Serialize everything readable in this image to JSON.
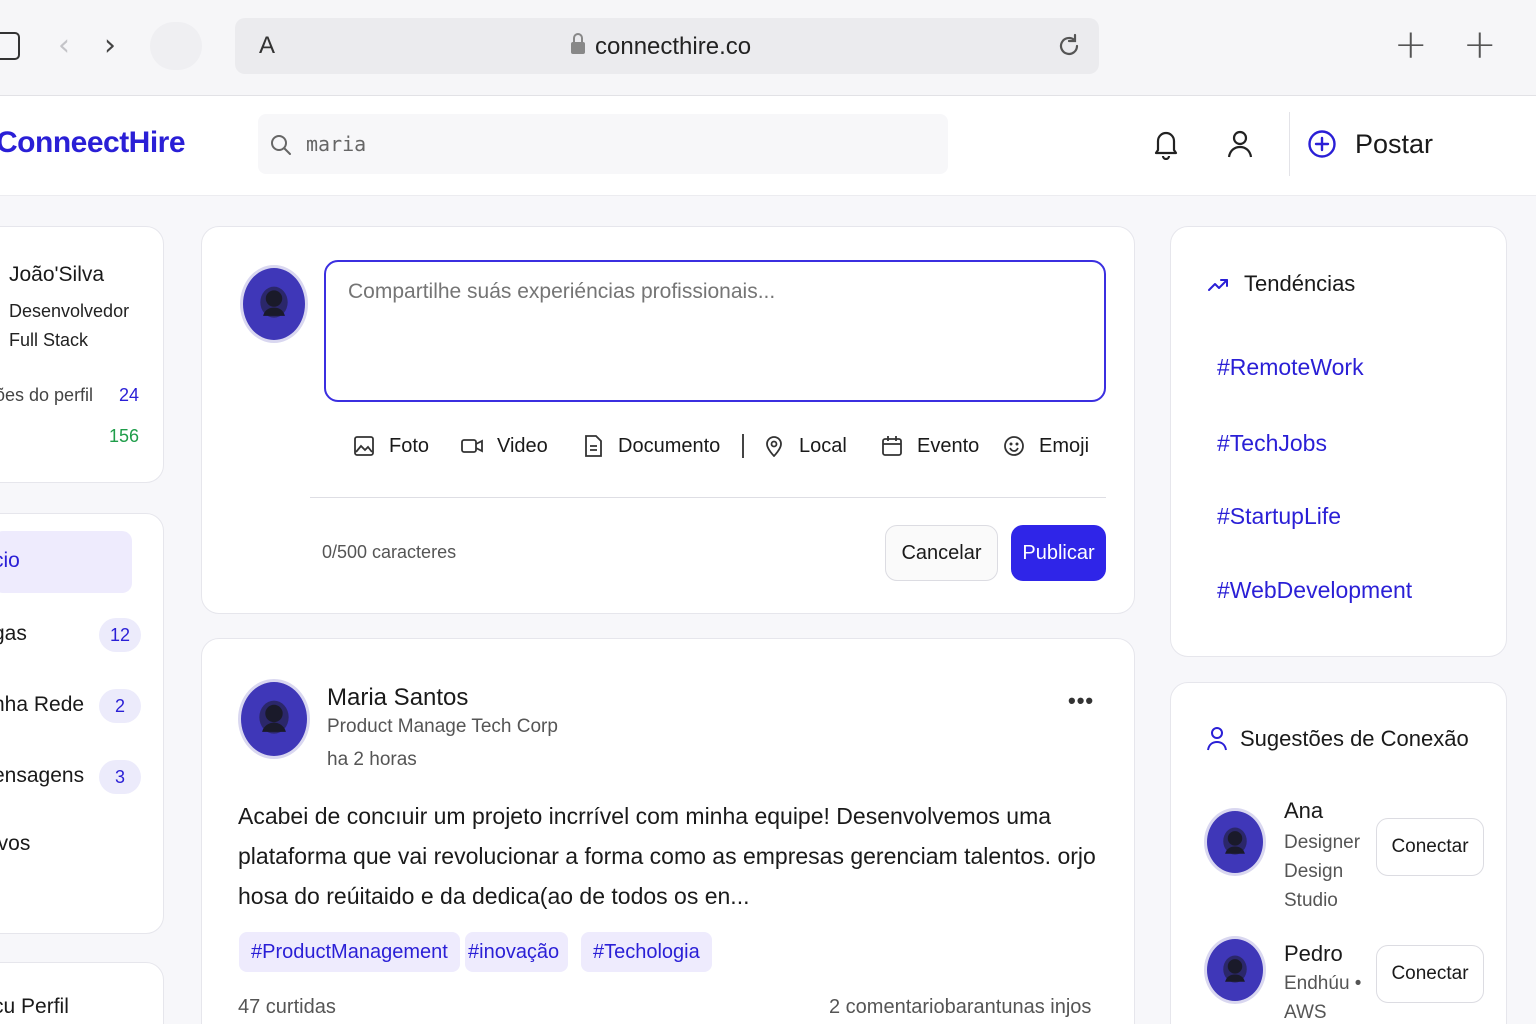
{
  "browser": {
    "reader_label": "A",
    "url": "connecthire.co"
  },
  "header": {
    "logo": "ConneectHire",
    "search_value": "maria",
    "post_label": "Postar"
  },
  "profile": {
    "name": "João'Silva",
    "role": "Desenvolvedor Full Stack",
    "stats": [
      {
        "label": "ões do perfil",
        "value": "24",
        "color": "#2a1fd6"
      },
      {
        "label": "",
        "value": "156",
        "color": "#1f9d4a"
      }
    ]
  },
  "nav": {
    "items": [
      {
        "label": "cio",
        "badge": "",
        "active": true
      },
      {
        "label": "gas",
        "badge": "12"
      },
      {
        "label": "nha Rede",
        "badge": "2"
      },
      {
        "label": "ensagens",
        "badge": "3"
      },
      {
        "label": "lvos",
        "badge": ""
      }
    ],
    "my_profile": "cu Perfil"
  },
  "composer": {
    "placeholder": "Compartilhe suás experiéncias profissionais...",
    "attachments": [
      "Foto",
      "Video",
      "Documento",
      "Local",
      "Evento",
      "Emoji"
    ],
    "counter": "0/500 caracteres",
    "cancel": "Cancelar",
    "publish": "Publicar"
  },
  "post": {
    "author": "Maria Santos",
    "subtitle": "Product Manage Tech Corp",
    "time": "ha 2 horas",
    "more": "•••",
    "body": "Acabei de concıuir um projeto incrrível com minha equipe! Desenvolvemos uma plataforma que vai revolucionar a forma como as empresas gerenciam talentos. orjo hosa do reúitaido e da dedica(ao de todos os en...",
    "tags": [
      "#ProductManagement",
      "#inovação",
      "#Techologia"
    ],
    "likes": "47 curtidas",
    "comments": "2 comentariobarantunas injos"
  },
  "trends": {
    "title": "Tendéncias",
    "items": [
      "#RemoteWork",
      "#TechJobs",
      "#StartupLife",
      "#WebDevelopment"
    ]
  },
  "suggestions": {
    "title": "Sugestões de Conexão",
    "items": [
      {
        "name": "Ana",
        "role": "Designer Design Studio",
        "action": "Conectar"
      },
      {
        "name": "Pedro",
        "role": "Endhúu • AWS",
        "action": "Conectar"
      }
    ]
  },
  "colors": {
    "accent": "#2a1fd6",
    "publish_bg": "#2f25e8",
    "avatar_bg": "#3f37b8",
    "active_nav_bg": "#eeebfd"
  }
}
